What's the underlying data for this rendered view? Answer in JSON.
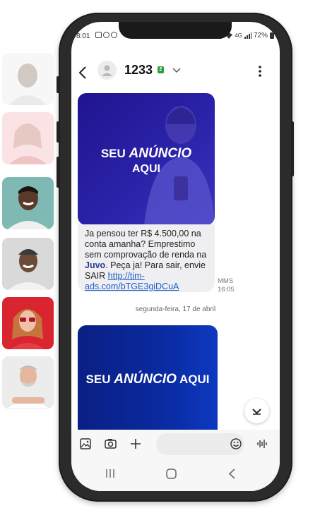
{
  "status_bar": {
    "time": "8:01",
    "signal_text": "4G",
    "battery": "72%"
  },
  "header": {
    "contact_name": "1233",
    "sim_label": "2"
  },
  "messages": {
    "ad_primary_line1": "SEU",
    "ad_primary_emphasis": "ANÚNCIO",
    "ad_primary_line2": "AQUI",
    "bubble_text_before": "Ja pensou ter R$ 4.500,00 na conta amanha? Emprestimo sem comprovação de renda na ",
    "bubble_brand": "Juvo",
    "bubble_text_after": ". Peça ja! Para sair, envie SAIR ",
    "bubble_link": "http://tim-ads.com/bTGE3giDCuA",
    "message_type": "MMS",
    "message_time": "16:05",
    "date_separator": "segunda-feira, 17 de abril",
    "ad_second_prefix": "SEU",
    "ad_second_emphasis": "ANÚNCIO",
    "ad_second_suffix": "AQUI"
  },
  "icons": {
    "back": "back-arrow-icon",
    "chevron": "chevron-down-icon",
    "menu": "more-vertical-icon",
    "gallery": "gallery-icon",
    "camera": "camera-icon",
    "add": "plus-icon",
    "emoji": "emoji-icon",
    "voice": "voice-waveform-icon"
  },
  "colors": {
    "ad_primary": "#2a22a8",
    "ad_secondary": "#0a2aa0",
    "brand": "#2b3a8f",
    "link": "#1b5fcc",
    "sim_badge": "#2e9d3e"
  }
}
